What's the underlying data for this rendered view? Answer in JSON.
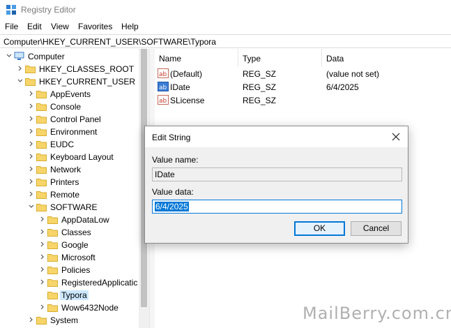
{
  "window": {
    "title": "Registry Editor",
    "icon": "regedit-icon"
  },
  "menu": [
    "File",
    "Edit",
    "View",
    "Favorites",
    "Help"
  ],
  "address": "Computer\\HKEY_CURRENT_USER\\SOFTWARE\\Typora",
  "tree": [
    {
      "label": "Computer",
      "icon": "computer-icon",
      "expanded": true
    },
    {
      "label": "HKEY_CLASSES_ROOT",
      "icon": "folder-icon",
      "expanded": false
    },
    {
      "label": "HKEY_CURRENT_USER",
      "icon": "folder-icon",
      "expanded": true
    },
    {
      "label": "AppEvents",
      "icon": "folder-icon",
      "expanded": false
    },
    {
      "label": "Console",
      "icon": "folder-icon",
      "expanded": false
    },
    {
      "label": "Control Panel",
      "icon": "folder-icon",
      "expanded": false
    },
    {
      "label": "Environment",
      "icon": "folder-icon",
      "expanded": false
    },
    {
      "label": "EUDC",
      "icon": "folder-icon",
      "expanded": false
    },
    {
      "label": "Keyboard Layout",
      "icon": "folder-icon",
      "expanded": false
    },
    {
      "label": "Network",
      "icon": "folder-icon",
      "expanded": false
    },
    {
      "label": "Printers",
      "icon": "folder-icon",
      "expanded": false
    },
    {
      "label": "Remote",
      "icon": "folder-icon",
      "expanded": false
    },
    {
      "label": "SOFTWARE",
      "icon": "folder-icon",
      "expanded": true
    },
    {
      "label": "AppDataLow",
      "icon": "folder-icon",
      "expanded": false
    },
    {
      "label": "Classes",
      "icon": "folder-icon",
      "expanded": false
    },
    {
      "label": "Google",
      "icon": "folder-icon",
      "expanded": false
    },
    {
      "label": "Microsoft",
      "icon": "folder-icon",
      "expanded": false
    },
    {
      "label": "Policies",
      "icon": "folder-icon",
      "expanded": false
    },
    {
      "label": "RegisteredApplicatic",
      "icon": "folder-icon",
      "expanded": false
    },
    {
      "label": "Typora",
      "icon": "folder-icon",
      "expanded": false,
      "selected": true
    },
    {
      "label": "Wow6432Node",
      "icon": "folder-icon",
      "expanded": false
    },
    {
      "label": "System",
      "icon": "folder-icon",
      "expanded": false
    }
  ],
  "list": {
    "columns": [
      "Name",
      "Type",
      "Data"
    ],
    "rows": [
      {
        "name": "(Default)",
        "type": "REG_SZ",
        "data": "(value not set)",
        "icon": "string-value-icon"
      },
      {
        "name": "IDate",
        "type": "REG_SZ",
        "data": "6/4/2025",
        "icon": "string-value-icon"
      },
      {
        "name": "SLicense",
        "type": "REG_SZ",
        "data": "",
        "icon": "string-value-icon"
      }
    ]
  },
  "dialog": {
    "title": "Edit String",
    "value_name_label": "Value name:",
    "value_name": "IDate",
    "value_data_label": "Value data:",
    "value_data": "6/4/2025",
    "ok_label": "OK",
    "cancel_label": "Cancel"
  },
  "watermark": "MailBerry.com.cn"
}
